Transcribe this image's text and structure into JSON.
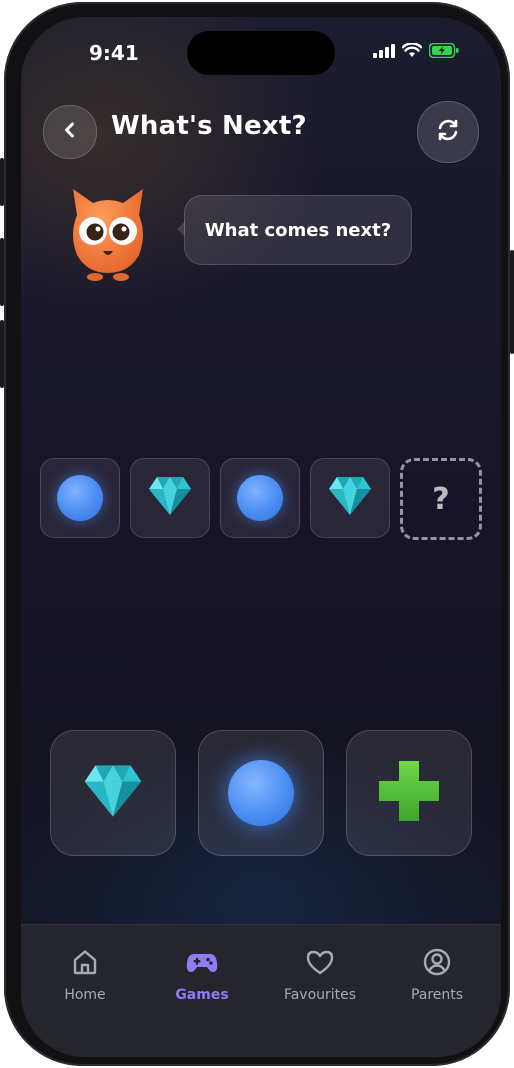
{
  "status": {
    "time": "9:41"
  },
  "header": {
    "title": "What's Next?"
  },
  "prompt": {
    "text": "What comes next?"
  },
  "sequence": {
    "items": [
      "circle",
      "diamond",
      "circle",
      "diamond"
    ],
    "missing_label": "?"
  },
  "options": [
    "diamond",
    "circle",
    "plus"
  ],
  "tabs": [
    {
      "label": "Home",
      "icon": "home-icon",
      "active": false
    },
    {
      "label": "Games",
      "icon": "gamepad-icon",
      "active": true
    },
    {
      "label": "Favourites",
      "icon": "heart-icon",
      "active": false
    },
    {
      "label": "Parents",
      "icon": "user-circle-icon",
      "active": false
    }
  ],
  "colors": {
    "accent": "#8f7cf6",
    "circle": "#4a8cf2",
    "diamond": "#2fc4cf",
    "plus": "#58c23d",
    "mascot": "#f07a3c"
  }
}
